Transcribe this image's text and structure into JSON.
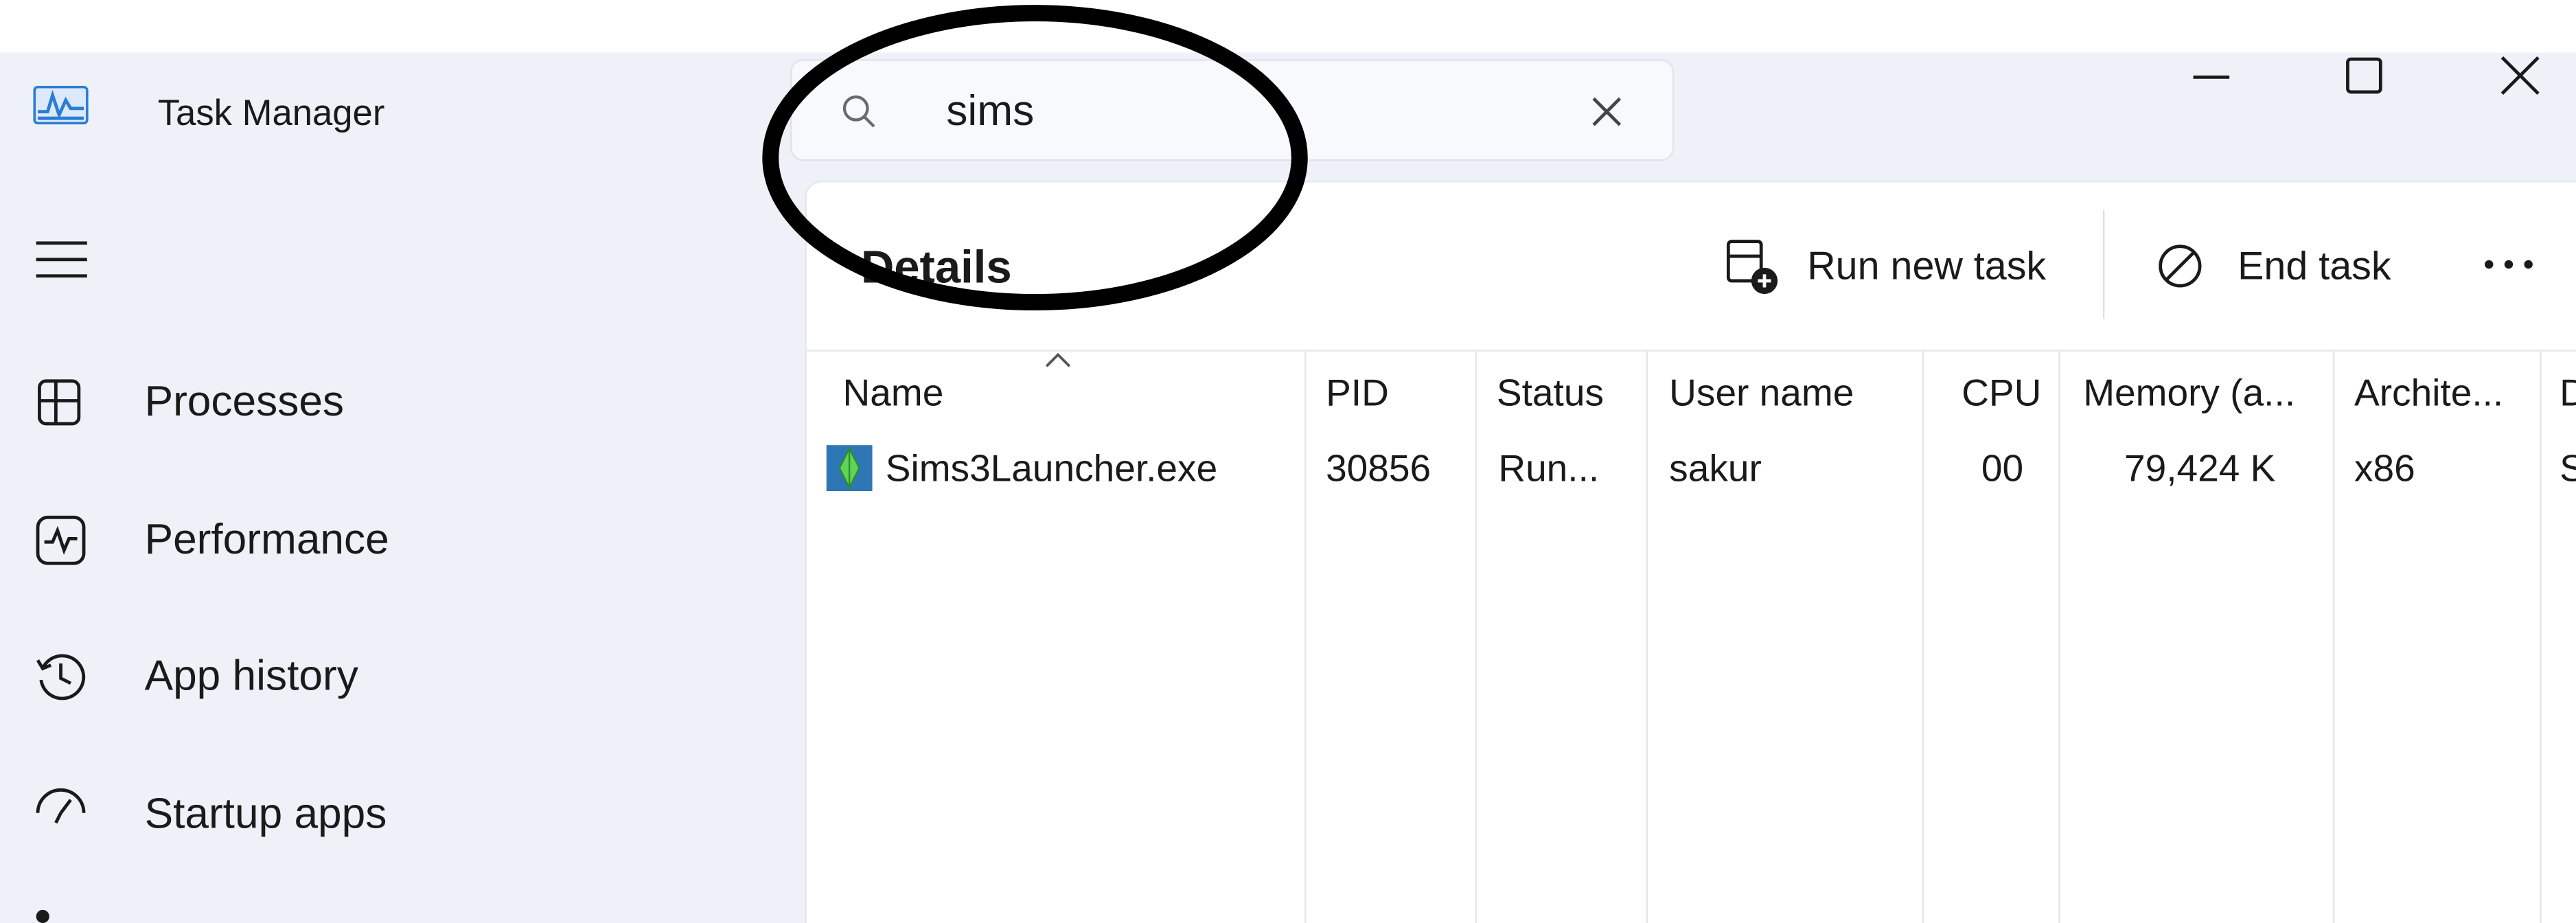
{
  "window": {
    "title": "Task Manager"
  },
  "search": {
    "value": "sims"
  },
  "sidebar": {
    "items": [
      {
        "label": "Processes",
        "icon": "processes-icon"
      },
      {
        "label": "Performance",
        "icon": "performance-icon"
      },
      {
        "label": "App history",
        "icon": "app-history-icon"
      },
      {
        "label": "Startup apps",
        "icon": "startup-apps-icon"
      }
    ]
  },
  "main": {
    "title": "Details",
    "run_new_task": "Run new task",
    "end_task": "End task"
  },
  "table": {
    "columns": [
      "Name",
      "PID",
      "Status",
      "User name",
      "CPU",
      "Memory (a...",
      "Archite...",
      "D"
    ],
    "rows": [
      {
        "name": "Sims3Launcher.exe",
        "pid": "30856",
        "status": "Run...",
        "user": "sakur",
        "cpu": "00",
        "memory": "79,424 K",
        "arch": "x86",
        "desc": "S"
      }
    ]
  },
  "colors": {
    "window_bg": "#eef2f8",
    "panel_bg": "#ffffff",
    "accent": "#2b7cd3",
    "annotation": "#000000"
  }
}
